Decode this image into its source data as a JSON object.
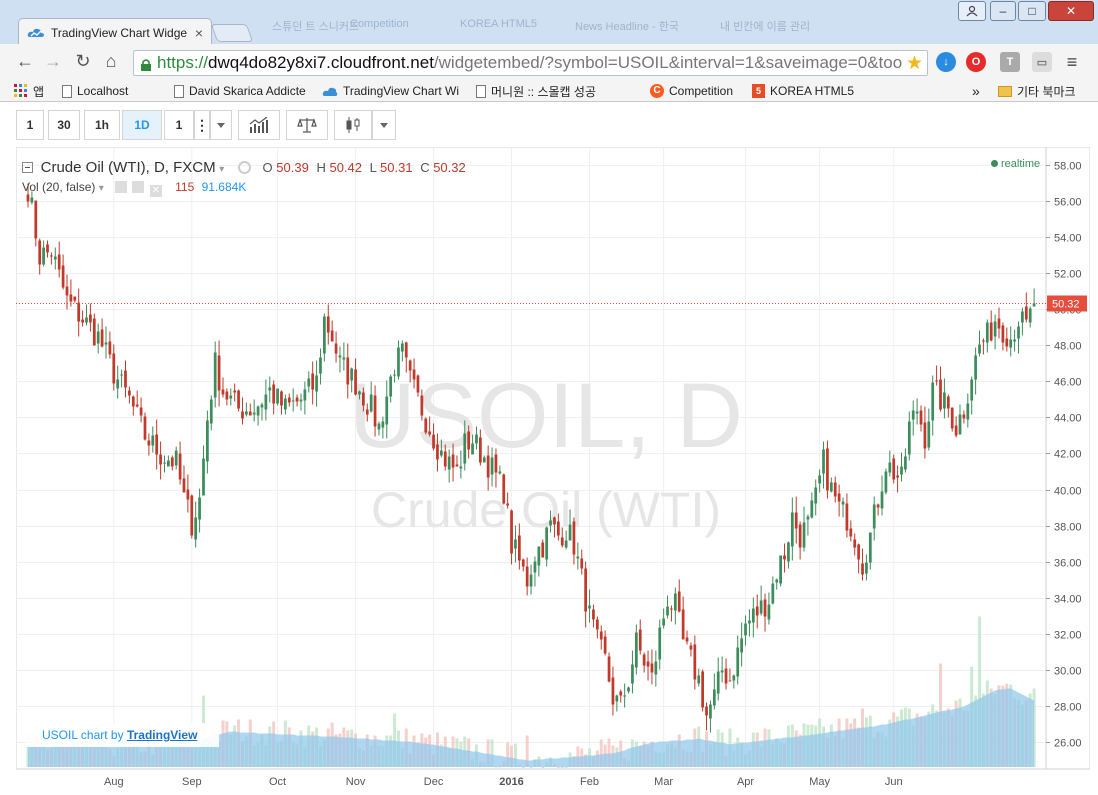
{
  "browser": {
    "active_tab_title": "TradingView Chart Widge",
    "tab_close": "×",
    "background_tabs": [
      "스튜던 트 스니커즈",
      "Competition",
      "KOREA HTML5",
      "News Headline - 한국",
      "내 빈칸에 이름 관리"
    ],
    "url_scheme": "https://",
    "url_host": "dwq4do82y8xi7.cloudfront.net",
    "url_path": "/widgetembed/?symbol=USOIL&interval=1&saveimage=0&too",
    "bookmarks": [
      {
        "label": "앱",
        "icon": "apps-grid-icon"
      },
      {
        "label": "Localhost",
        "icon": "page-icon"
      },
      {
        "label": "David Skarica Addicte",
        "icon": "page-icon"
      },
      {
        "label": "TradingView Chart Wi",
        "icon": "tradingview-cloud-icon"
      },
      {
        "label": "머니원 :: 스몰캡 성공",
        "icon": "page-icon"
      },
      {
        "label": "Competition",
        "icon": "c-logo-icon"
      },
      {
        "label": "KOREA HTML5",
        "icon": "html5-icon"
      }
    ],
    "bookmarks_overflow": "»",
    "other_bookmarks": "기타 북마크",
    "window_buttons": [
      "–",
      "□",
      "✕"
    ]
  },
  "chart_toolbar": {
    "intervals": [
      "1",
      "30",
      "1h",
      "1D",
      "1"
    ],
    "active_interval": "1D",
    "more": "⋮"
  },
  "legend": {
    "symbol": "Crude Oil (WTI), D, FXCM",
    "o_label": "O",
    "o": "50.39",
    "h_label": "H",
    "h": "50.42",
    "l_label": "L",
    "l": "50.31",
    "c_label": "C",
    "c": "50.32",
    "vol_study": "Vol (20, false)",
    "vol_value": "115",
    "vol_ma": "91.684K",
    "realtime": "realtime"
  },
  "watermark": {
    "symbol": "USOIL, D",
    "name": "Crude Oil (WTI)"
  },
  "credit": {
    "prefix": "USOIL chart by",
    "brand": "TradingView"
  },
  "colors": {
    "up": "#3d8c5c",
    "down": "#c0392b",
    "volume_ma": "#8ec6ec",
    "last_price": "#e74c3c",
    "realtime": "#3d8c5c"
  },
  "chart_data": {
    "type": "candlestick",
    "symbol": "USOIL",
    "y_axis": {
      "ticks": [
        "26.00",
        "28.00",
        "30.00",
        "32.00",
        "34.00",
        "36.00",
        "38.00",
        "40.00",
        "42.00",
        "44.00",
        "46.00",
        "48.00",
        "50.00",
        "52.00",
        "54.00",
        "56.00",
        "58.00"
      ],
      "ylim": [
        24.5,
        59
      ]
    },
    "x_axis": {
      "ticks": [
        "Aug",
        "Sep",
        "Oct",
        "Nov",
        "Dec",
        "2016",
        "Feb",
        "Mar",
        "Apr",
        "May",
        "Jun"
      ]
    },
    "last_price": 50.32,
    "last_price_label": "50.32",
    "close_path": [
      [
        0,
        56.8
      ],
      [
        3,
        53.0
      ],
      [
        6,
        53.2
      ],
      [
        10,
        50.5
      ],
      [
        14,
        49.5
      ],
      [
        18,
        48.5
      ],
      [
        22,
        46.5
      ],
      [
        26,
        45.0
      ],
      [
        30,
        43.0
      ],
      [
        34,
        42.0
      ],
      [
        38,
        41.5
      ],
      [
        40,
        39.5
      ],
      [
        42,
        38.2
      ],
      [
        44,
        39.5
      ],
      [
        46,
        44.0
      ],
      [
        48,
        47.0
      ],
      [
        50,
        45.5
      ],
      [
        54,
        44.5
      ],
      [
        58,
        44.5
      ],
      [
        62,
        45.5
      ],
      [
        66,
        44.5
      ],
      [
        70,
        45.0
      ],
      [
        74,
        46.0
      ],
      [
        76,
        49.5
      ],
      [
        78,
        48.5
      ],
      [
        80,
        47.0
      ],
      [
        84,
        46.0
      ],
      [
        88,
        44.5
      ],
      [
        90,
        43.5
      ],
      [
        94,
        47.0
      ],
      [
        96,
        47.5
      ],
      [
        98,
        46.0
      ],
      [
        102,
        44.0
      ],
      [
        106,
        42.0
      ],
      [
        110,
        41.0
      ],
      [
        112,
        42.5
      ],
      [
        114,
        42.8
      ],
      [
        118,
        41.5
      ],
      [
        122,
        40.0
      ],
      [
        124,
        37.0
      ],
      [
        126,
        36.0
      ],
      [
        128,
        35.0
      ],
      [
        130,
        36.5
      ],
      [
        132,
        37.0
      ],
      [
        134,
        38.0
      ],
      [
        136,
        37.5
      ],
      [
        138,
        37.8
      ],
      [
        140,
        37.0
      ],
      [
        142,
        35.0
      ],
      [
        144,
        33.0
      ],
      [
        146,
        31.5
      ],
      [
        148,
        30.5
      ],
      [
        150,
        28.5
      ],
      [
        152,
        28.0
      ],
      [
        154,
        29.5
      ],
      [
        156,
        31.5
      ],
      [
        158,
        30.5
      ],
      [
        160,
        29.5
      ],
      [
        162,
        32.0
      ],
      [
        164,
        34.0
      ],
      [
        166,
        33.5
      ],
      [
        168,
        31.5
      ],
      [
        170,
        30.5
      ],
      [
        172,
        29.5
      ],
      [
        174,
        27.5
      ],
      [
        176,
        28.5
      ],
      [
        178,
        30.0
      ],
      [
        180,
        29.5
      ],
      [
        182,
        31.0
      ],
      [
        184,
        32.5
      ],
      [
        186,
        33.0
      ],
      [
        188,
        33.5
      ],
      [
        190,
        34.0
      ],
      [
        192,
        35.5
      ],
      [
        194,
        36.5
      ],
      [
        196,
        38.5
      ],
      [
        198,
        37.5
      ],
      [
        200,
        38.0
      ],
      [
        202,
        39.5
      ],
      [
        204,
        41.5
      ],
      [
        206,
        40.0
      ],
      [
        208,
        39.0
      ],
      [
        210,
        38.5
      ],
      [
        212,
        37.5
      ],
      [
        214,
        36.0
      ],
      [
        216,
        37.5
      ],
      [
        218,
        39.5
      ],
      [
        220,
        41.5
      ],
      [
        222,
        41.0
      ],
      [
        224,
        40.5
      ],
      [
        226,
        43.5
      ],
      [
        228,
        44.5
      ],
      [
        230,
        43.0
      ],
      [
        232,
        45.5
      ],
      [
        234,
        45.0
      ],
      [
        236,
        44.5
      ],
      [
        238,
        43.5
      ],
      [
        240,
        44.5
      ],
      [
        242,
        46.5
      ],
      [
        244,
        48.0
      ],
      [
        246,
        48.5
      ],
      [
        248,
        49.5
      ],
      [
        250,
        49.0
      ],
      [
        252,
        48.5
      ],
      [
        254,
        49.5
      ],
      [
        256,
        49.0
      ],
      [
        258,
        50.32
      ]
    ],
    "volume_ma_path": [
      [
        0,
        25.8
      ],
      [
        20,
        25.8
      ],
      [
        40,
        25.9
      ],
      [
        52,
        26.6
      ],
      [
        60,
        26.5
      ],
      [
        80,
        26.3
      ],
      [
        100,
        26.0
      ],
      [
        120,
        25.3
      ],
      [
        128,
        25.0
      ],
      [
        140,
        25.2
      ],
      [
        150,
        25.4
      ],
      [
        160,
        26.0
      ],
      [
        172,
        26.2
      ],
      [
        180,
        25.9
      ],
      [
        200,
        26.4
      ],
      [
        220,
        27.0
      ],
      [
        240,
        28.0
      ],
      [
        248,
        28.9
      ],
      [
        252,
        29.0
      ],
      [
        258,
        28.3
      ]
    ],
    "volume_spikes": [
      [
        45,
        28.6
      ],
      [
        94,
        27.6
      ],
      [
        128,
        26.4
      ],
      [
        214,
        27.9
      ],
      [
        234,
        30.4
      ],
      [
        242,
        30.2
      ],
      [
        244,
        33.0
      ]
    ]
  }
}
